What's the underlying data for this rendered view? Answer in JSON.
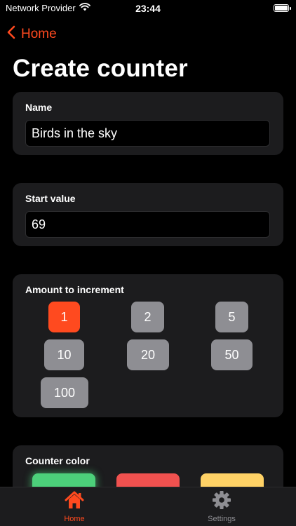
{
  "status_bar": {
    "carrier": "Network Provider",
    "time": "23:44"
  },
  "nav": {
    "back_label": "Home"
  },
  "page": {
    "title": "Create counter"
  },
  "name_card": {
    "label": "Name",
    "value": "Birds in the sky"
  },
  "start_card": {
    "label": "Start value",
    "value": "69"
  },
  "increment_card": {
    "label": "Amount to increment",
    "options": [
      "1",
      "2",
      "5",
      "10",
      "20",
      "50",
      "100"
    ],
    "selected": "1"
  },
  "color_card": {
    "label": "Counter color",
    "colors": [
      "#4cd07a",
      "#f0514f",
      "#ffd266"
    ]
  },
  "tab_bar": {
    "tabs": [
      {
        "label": "Home",
        "icon": "house-icon",
        "active": true
      },
      {
        "label": "Settings",
        "icon": "gear-icon",
        "active": false
      }
    ]
  },
  "colors": {
    "accent": "#ff4a1f",
    "card_background": "#1c1c1e",
    "button_gray": "#8e8e93",
    "inactive_tab": "#8e8e93"
  }
}
